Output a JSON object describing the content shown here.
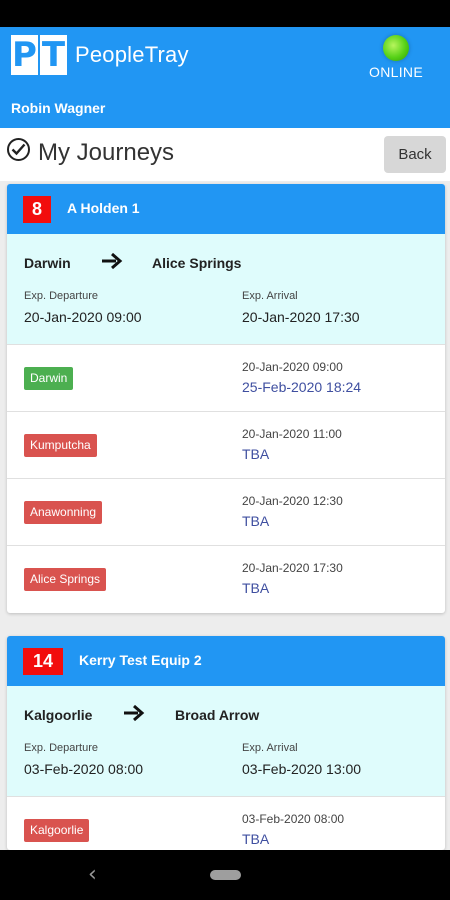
{
  "app": {
    "logo_letters": [
      "P",
      "T"
    ],
    "name": "PeopleTray",
    "status_label": "ONLINE",
    "status_color": "#56d117",
    "user_name": "Robin Wagner"
  },
  "header": {
    "icon": "check-circle-icon",
    "title": "My Journeys",
    "back_label": "Back"
  },
  "colors": {
    "primary": "#2196f3",
    "badge": "#f20d0d",
    "summary_bg": "#dffcfc",
    "chip_green": "#4caf50",
    "chip_red": "#d9534f",
    "actual_text": "#3f4fa0"
  },
  "journeys": [
    {
      "number": "8",
      "vehicle": "A Holden 1",
      "from": "Darwin",
      "to": "Alice Springs",
      "dep_label": "Exp. Departure",
      "dep_value": "20-Jan-2020 09:00",
      "arr_label": "Exp. Arrival",
      "arr_value": "20-Jan-2020 17:30",
      "stops": [
        {
          "name": "Darwin",
          "status": "green",
          "scheduled": "20-Jan-2020 09:00",
          "actual": "25-Feb-2020 18:24"
        },
        {
          "name": "Kumputcha",
          "status": "red",
          "scheduled": "20-Jan-2020 11:00",
          "actual": "TBA"
        },
        {
          "name": "Anawonning",
          "status": "red",
          "scheduled": "20-Jan-2020 12:30",
          "actual": "TBA"
        },
        {
          "name": "Alice Springs",
          "status": "red",
          "scheduled": "20-Jan-2020 17:30",
          "actual": "TBA"
        }
      ]
    },
    {
      "number": "14",
      "vehicle": "Kerry Test Equip 2",
      "from": "Kalgoorlie",
      "to": "Broad Arrow",
      "dep_label": "Exp. Departure",
      "dep_value": "03-Feb-2020 08:00",
      "arr_label": "Exp. Arrival",
      "arr_value": "03-Feb-2020 13:00",
      "stops": [
        {
          "name": "Kalgoorlie",
          "status": "red",
          "scheduled": "03-Feb-2020 08:00",
          "actual": "TBA"
        }
      ]
    }
  ],
  "navbar": {
    "back_icon": "nav-back-icon",
    "home_icon": "nav-home-pill-icon"
  }
}
